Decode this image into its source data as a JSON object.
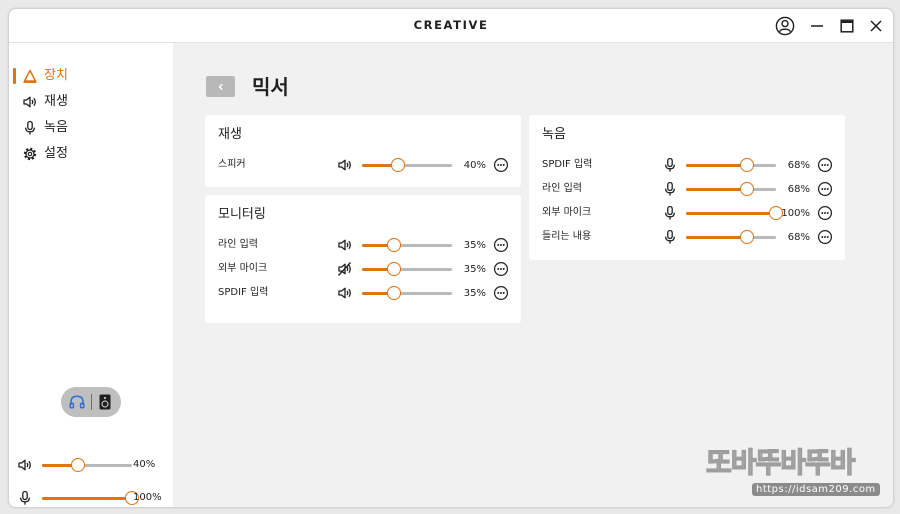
{
  "window": {
    "brand": "CREATIVE",
    "controls": [
      "user-icon",
      "minimize-icon",
      "maximize-icon",
      "close-icon"
    ]
  },
  "sidebar": {
    "items": [
      {
        "label": "장치",
        "icon": "device-icon",
        "active": true
      },
      {
        "label": "재생",
        "icon": "speaker-icon",
        "active": false
      },
      {
        "label": "녹음",
        "icon": "microphone-icon",
        "active": false
      },
      {
        "label": "설정",
        "icon": "gear-icon",
        "active": false
      }
    ],
    "output_toggle": {
      "options": [
        "headphones-icon",
        "speaker-box-icon"
      ],
      "selected": "headphones-icon"
    },
    "master_volume": {
      "icon": "speaker-icon",
      "value": 40,
      "label": "40%"
    },
    "master_mic": {
      "icon": "microphone-icon",
      "value": 100,
      "label": "100%"
    }
  },
  "main": {
    "back_icon": "chevron-left-icon",
    "title": "믹서",
    "cards": {
      "playback": {
        "title": "재생",
        "rows": [
          {
            "label": "스피커",
            "icon": "speaker-icon",
            "value": 40,
            "pct": "40%"
          }
        ]
      },
      "monitoring": {
        "title": "모니터링",
        "rows": [
          {
            "label": "라인 입력",
            "icon": "speaker-icon",
            "value": 35,
            "pct": "35%"
          },
          {
            "label": "외부 마이크",
            "icon": "speaker-muted-icon",
            "value": 35,
            "pct": "35%"
          },
          {
            "label": "SPDIF 입력",
            "icon": "speaker-icon",
            "value": 35,
            "pct": "35%"
          }
        ]
      },
      "recording": {
        "title": "녹음",
        "rows": [
          {
            "label": "SPDIF 입력",
            "icon": "microphone-icon",
            "value": 68,
            "pct": "68%"
          },
          {
            "label": "라인 입력",
            "icon": "microphone-icon",
            "value": 68,
            "pct": "68%"
          },
          {
            "label": "외부 마이크",
            "icon": "microphone-icon",
            "value": 100,
            "pct": "100%"
          },
          {
            "label": "들리는 내용",
            "icon": "microphone-icon",
            "value": 68,
            "pct": "68%"
          }
        ]
      }
    },
    "more_icon": "more-options-icon"
  },
  "watermark": {
    "text": "또바뚜바뚜바",
    "url": "https://idsam209.com"
  },
  "colors": {
    "accent": "#e3730e",
    "track": "#b9b9b9",
    "card": "#ffffff",
    "background": "#f1f1f1"
  }
}
